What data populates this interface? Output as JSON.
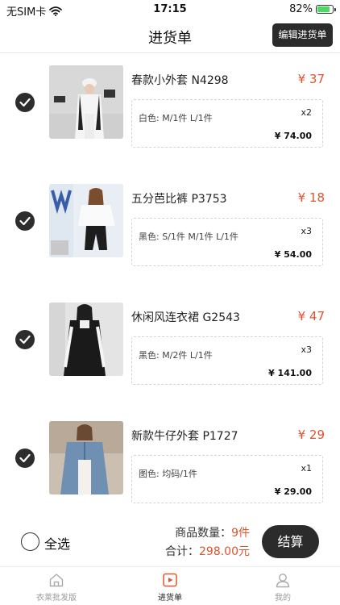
{
  "status_bar": {
    "carrier": "无SIM卡",
    "time": "17:15",
    "battery": "82%",
    "battery_level": 0.82
  },
  "nav": {
    "title": "进货单",
    "edit_label": "编辑进货单"
  },
  "items": [
    {
      "name": "春款小外套  N4298",
      "price": "¥ 37",
      "spec": "白色: M/1件 L/1件",
      "qty": "x2",
      "subtotal": "¥ 74.00"
    },
    {
      "name": "五分芭比裤  P3753",
      "price": "¥ 18",
      "spec": "黑色: S/1件 M/1件 L/1件",
      "qty": "x3",
      "subtotal": "¥ 54.00"
    },
    {
      "name": "休闲风连衣裙  G2543",
      "price": "¥ 47",
      "spec": "黑色: M/2件 L/1件",
      "qty": "x3",
      "subtotal": "¥ 141.00"
    },
    {
      "name": "新款牛仔外套  P1727",
      "price": "¥ 29",
      "spec": "图色: 均码/1件",
      "qty": "x1",
      "subtotal": "¥ 29.00"
    }
  ],
  "summary": {
    "select_all": "全选",
    "qty_label": "商品数量：",
    "qty_value": "9件",
    "total_label": "合计：",
    "total_value": "298.00元",
    "checkout": "结算"
  },
  "tabs": [
    {
      "label": "衣莱批发版",
      "icon": "home-icon",
      "active": false
    },
    {
      "label": "进货单",
      "icon": "play-icon",
      "active": true
    },
    {
      "label": "我的",
      "icon": "user-icon",
      "active": false
    }
  ],
  "colors": {
    "accent": "#e1522f",
    "dark": "#2b2b2b",
    "battery": "#4cd964"
  }
}
